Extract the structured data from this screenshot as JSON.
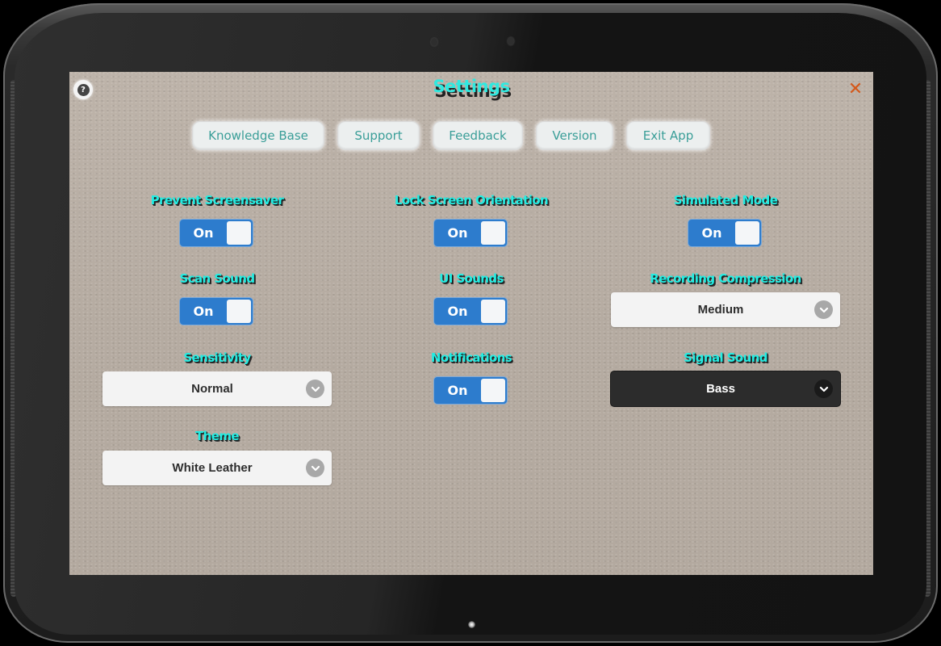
{
  "header": {
    "title": "Settings",
    "help_icon_glyph": "?",
    "close_icon_glyph": "✕"
  },
  "nav": {
    "buttons": [
      {
        "label": "Knowledge Base"
      },
      {
        "label": "Support"
      },
      {
        "label": "Feedback"
      },
      {
        "label": "Version"
      },
      {
        "label": "Exit App"
      }
    ]
  },
  "settings": {
    "prevent_screensaver": {
      "label": "Prevent Screensaver",
      "value": "On",
      "state": true
    },
    "lock_screen_orientation": {
      "label": "Lock Screen Orientation",
      "value": "On",
      "state": true
    },
    "simulated_mode": {
      "label": "Simulated Mode",
      "value": "On",
      "state": true
    },
    "scan_sound": {
      "label": "Scan Sound",
      "value": "On",
      "state": true
    },
    "ui_sounds": {
      "label": "UI Sounds",
      "value": "On",
      "state": true
    },
    "recording_compression": {
      "label": "Recording Compression",
      "value": "Medium"
    },
    "sensitivity": {
      "label": "Sensitivity",
      "value": "Normal"
    },
    "notifications": {
      "label": "Notifications",
      "value": "On",
      "state": true
    },
    "signal_sound": {
      "label": "Signal Sound",
      "value": "Bass"
    },
    "theme": {
      "label": "Theme",
      "value": "White Leather"
    }
  },
  "colors": {
    "label_text": "#24ece2",
    "toggle_on": "#2d7ccd",
    "close_accent": "#d4581a",
    "nav_text": "#3a9e98",
    "background": "#b7ada3"
  }
}
